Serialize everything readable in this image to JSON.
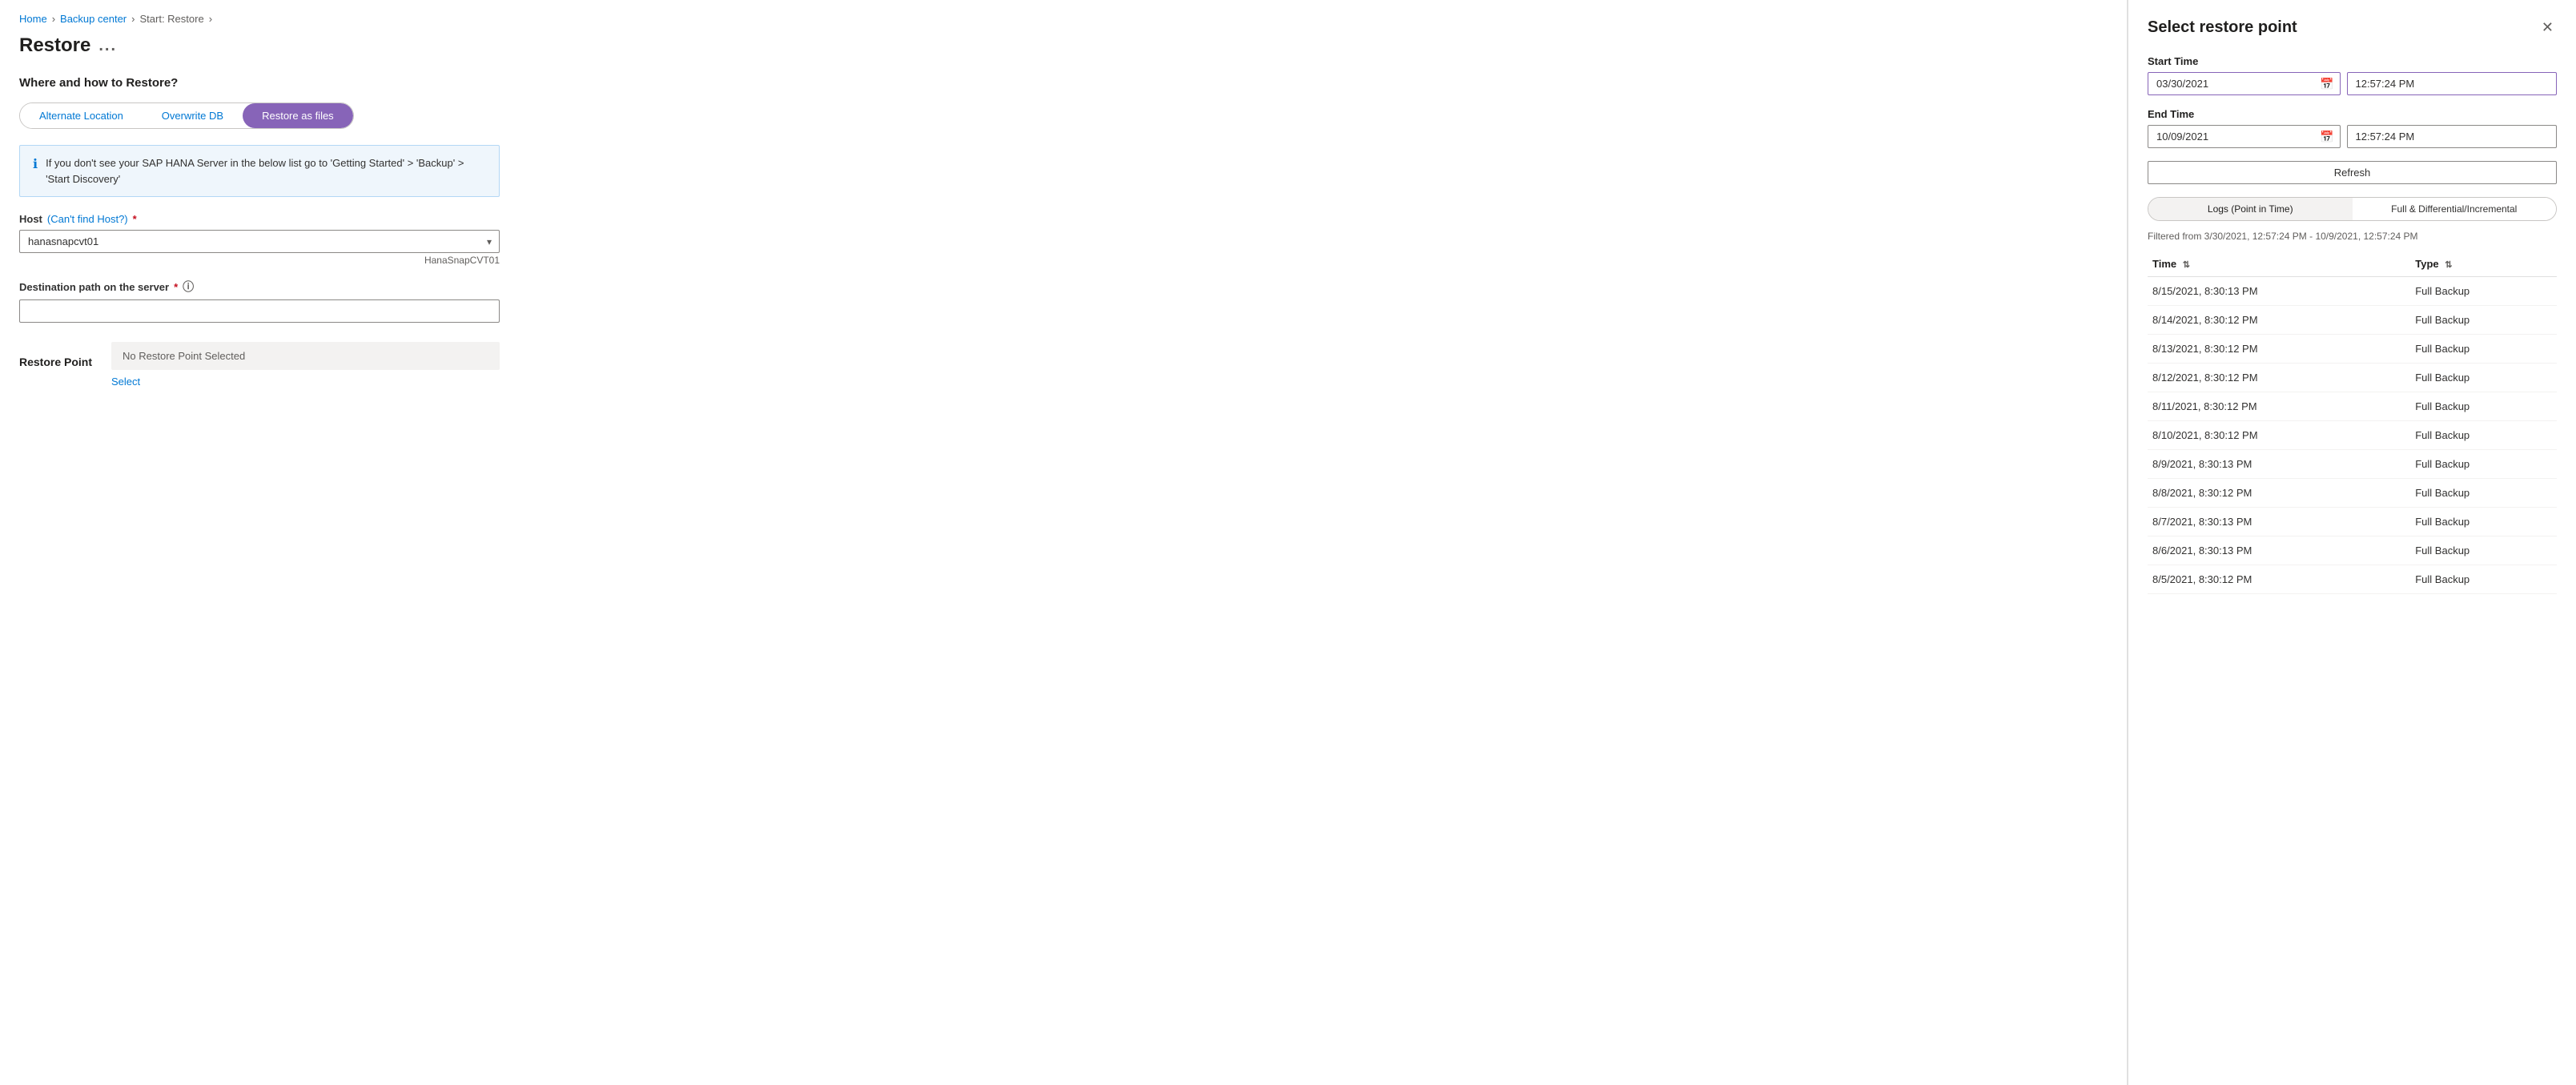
{
  "breadcrumb": {
    "home": "Home",
    "backup_center": "Backup center",
    "start_restore": "Start: Restore",
    "sep1": ">",
    "sep2": ">",
    "sep3": ">"
  },
  "page": {
    "title": "Restore",
    "more_btn": "..."
  },
  "form": {
    "section_title": "Where and how to Restore?",
    "tabs": [
      {
        "label": "Alternate Location",
        "active": false
      },
      {
        "label": "Overwrite DB",
        "active": false
      },
      {
        "label": "Restore as files",
        "active": true
      }
    ],
    "info_text": "If you don't see your SAP HANA Server in the below list go to 'Getting Started' > 'Backup' > 'Start Discovery'",
    "host_label": "Host",
    "host_link": "(Can't find Host?)",
    "host_required": "*",
    "host_options": [
      "hanasnapcvt01"
    ],
    "host_selected": "hanasnapcvt01",
    "host_hint": "HanaSnapCVT01",
    "dest_label": "Destination path on the server",
    "dest_required": "*",
    "dest_placeholder": "",
    "restore_point_label": "Restore Point",
    "restore_point_display": "No Restore Point Selected",
    "select_link": "Select"
  },
  "panel": {
    "title": "Select restore point",
    "start_time_label": "Start Time",
    "start_date": "03/30/2021",
    "start_time": "12:57:24 PM",
    "end_time_label": "End Time",
    "end_date": "10/09/2021",
    "end_time": "12:57:24 PM",
    "refresh_label": "Refresh",
    "tabs": [
      {
        "label": "Logs (Point in Time)",
        "active": true
      },
      {
        "label": "Full & Differential/Incremental",
        "active": false
      }
    ],
    "filter_text": "Filtered from 3/30/2021, 12:57:24 PM - 10/9/2021, 12:57:24 PM",
    "table_headers": [
      {
        "label": "Time",
        "sortable": true
      },
      {
        "label": "Type",
        "sortable": true
      }
    ],
    "table_rows": [
      {
        "time": "8/15/2021, 8:30:13 PM",
        "type": "Full Backup"
      },
      {
        "time": "8/14/2021, 8:30:12 PM",
        "type": "Full Backup"
      },
      {
        "time": "8/13/2021, 8:30:12 PM",
        "type": "Full Backup"
      },
      {
        "time": "8/12/2021, 8:30:12 PM",
        "type": "Full Backup"
      },
      {
        "time": "8/11/2021, 8:30:12 PM",
        "type": "Full Backup"
      },
      {
        "time": "8/10/2021, 8:30:12 PM",
        "type": "Full Backup"
      },
      {
        "time": "8/9/2021, 8:30:13 PM",
        "type": "Full Backup"
      },
      {
        "time": "8/8/2021, 8:30:12 PM",
        "type": "Full Backup"
      },
      {
        "time": "8/7/2021, 8:30:13 PM",
        "type": "Full Backup"
      },
      {
        "time": "8/6/2021, 8:30:13 PM",
        "type": "Full Backup"
      },
      {
        "time": "8/5/2021, 8:30:12 PM",
        "type": "Full Backup"
      }
    ]
  },
  "colors": {
    "accent_purple": "#8764b8",
    "accent_blue": "#0078d4",
    "border": "#c8c6c4",
    "bg_light": "#f3f2f1"
  }
}
